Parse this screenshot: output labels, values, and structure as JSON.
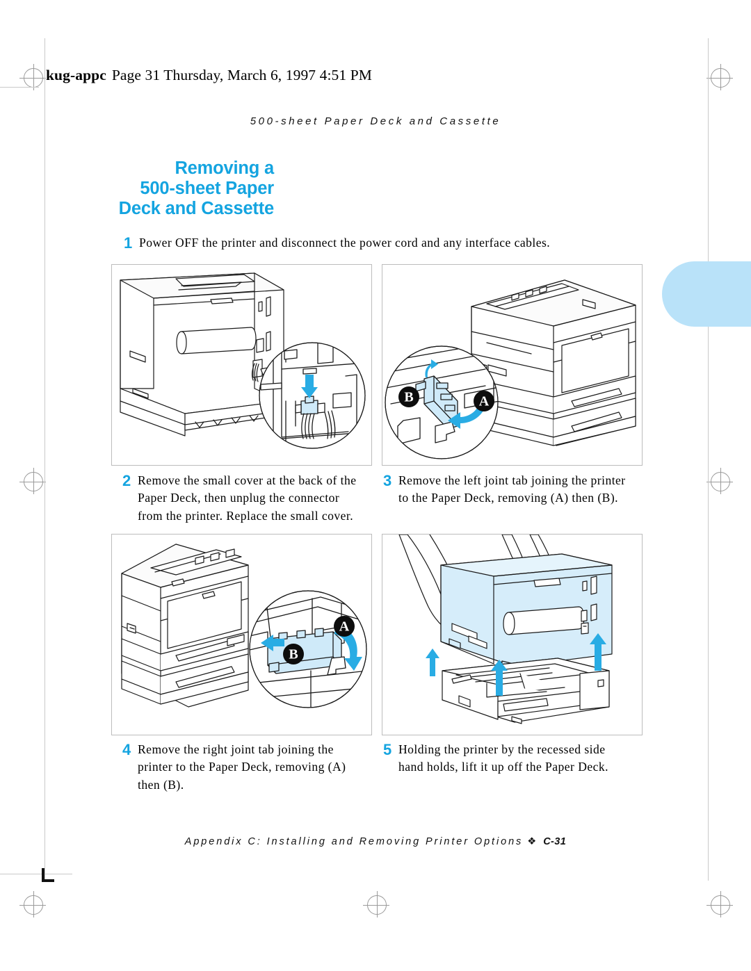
{
  "file_header": {
    "filename": "kug-appc",
    "rest": "Page 31  Thursday, March 6, 1997  4:51 PM",
    "full": "kug-appc  Page 31  Thursday, March 6, 1997  4:51 PM"
  },
  "running_header": "500-sheet Paper Deck and Cassette",
  "section_title": {
    "line1": "Removing a",
    "line2": "500-sheet Paper",
    "line3": "Deck and Cassette",
    "color": "#14a4e0"
  },
  "steps": [
    {
      "number": "1",
      "text": "Power OFF the printer and disconnect the power cord and any interface cables."
    },
    {
      "number": "2",
      "text": "Remove the small cover at the back of the Paper Deck, then unplug the connector from the printer. Replace the small cover."
    },
    {
      "number": "3",
      "text": "Remove the left joint tab joining the printer to the Paper Deck, removing (A) then (B)."
    },
    {
      "number": "4",
      "text": "Remove the right joint tab joining the printer to the Paper Deck, removing (A) then (B)."
    },
    {
      "number": "5",
      "text": "Holding the printer by the recessed side hand holds, lift it up off the Paper Deck."
    }
  ],
  "figures": [
    {
      "id": "panel-2",
      "caption_step": "2",
      "description": "Rear three-quarter view of laser printer on 500-sheet Paper Deck with magnified callout circle showing the connector being unplugged downward",
      "callout_labels": [],
      "arrow_color": "#29ace4",
      "highlight_color": "#cfeaf9"
    },
    {
      "id": "panel-3",
      "caption_step": "3",
      "description": "Front three-quarter view of printer on Paper Deck with magnified callout circle at left showing the left joint tab removal",
      "callout_labels": [
        "B",
        "A"
      ],
      "arrow_color": "#29ace4",
      "highlight_color": "#cfeaf9"
    },
    {
      "id": "panel-4",
      "caption_step": "4",
      "description": "Front three-quarter view of printer on Paper Deck with magnified callout circle at right showing the right joint tab removal",
      "callout_labels": [
        "A",
        "B"
      ],
      "arrow_color": "#29ace4",
      "highlight_color": "#cfeaf9"
    },
    {
      "id": "panel-5",
      "caption_step": "5",
      "description": "Two hands lifting the printer straight up off the Paper Deck, three blue up arrows indicating lift direction",
      "callout_labels": [],
      "arrow_color": "#29ace4",
      "highlight_color": "#d6edfa"
    }
  ],
  "thumb_tab": {
    "color": "#b9e2f9"
  },
  "footer": {
    "text": "Appendix C: Installing and Removing Printer Options",
    "separator": "❖",
    "page_number": "C-31"
  }
}
